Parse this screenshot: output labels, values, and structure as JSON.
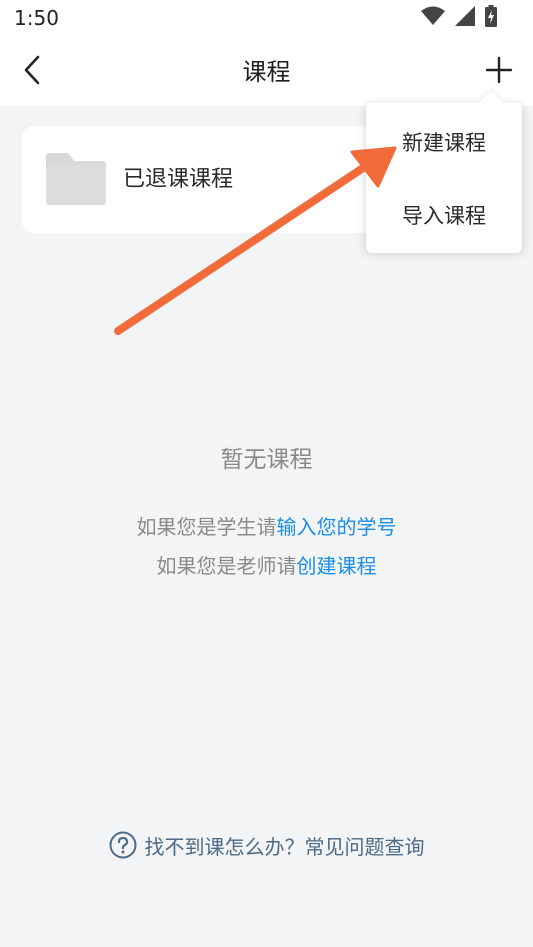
{
  "status_bar": {
    "time": "1:50",
    "icons": [
      "wifi-icon",
      "signal-icon",
      "battery-icon"
    ]
  },
  "nav": {
    "title": "课程",
    "back_icon": "chevron-left-icon",
    "add_icon": "plus-icon"
  },
  "folder_card": {
    "icon": "folder-icon",
    "label": "已退课课程"
  },
  "dropdown": {
    "items": [
      {
        "label": "新建课程"
      },
      {
        "label": "导入课程"
      }
    ]
  },
  "empty_state": {
    "title": "暂无课程",
    "student_prefix": "如果您是学生请",
    "student_link": "输入您的学号",
    "teacher_prefix": "如果您是老师请",
    "teacher_link": "创建课程"
  },
  "help": {
    "icon": "question-circle-icon",
    "text": "找不到课怎么办？常见问题查询"
  },
  "colors": {
    "background": "#f3f4f6",
    "link": "#1a8ee8",
    "annotation_arrow": "#f26b3a",
    "help_text": "#4d6a88",
    "folder_icon": "#d8d8d8"
  }
}
